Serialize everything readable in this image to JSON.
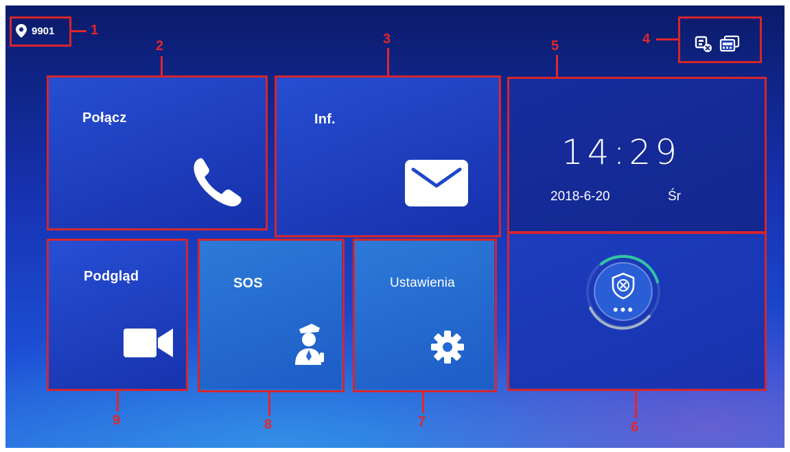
{
  "status_bar": {
    "room_number": "9901",
    "location_icon": "location-pin-icon",
    "status_icons": [
      "network-disconnected-icon",
      "monitor-windows-icon"
    ]
  },
  "tiles": {
    "call": {
      "label": "Połącz",
      "icon": "phone-icon"
    },
    "info": {
      "label": "Inf.",
      "icon": "envelope-icon"
    },
    "preview": {
      "label": "Podgląd",
      "icon": "video-camera-icon"
    },
    "sos": {
      "label": "SOS",
      "icon": "security-guard-icon"
    },
    "settings": {
      "label": "Ustawienia",
      "icon": "gear-icon"
    },
    "alarm": {
      "icon": "shield-disarmed-icon",
      "state_dots": "•••"
    }
  },
  "clock": {
    "time": "14:29",
    "date": "2018-6-20",
    "weekday": "Śr"
  },
  "callouts": [
    "1",
    "2",
    "3",
    "4",
    "5",
    "6",
    "7",
    "8",
    "9"
  ],
  "colors": {
    "accent_red": "#e3262b",
    "tile_blue": "#2450d0",
    "background_top": "#0b1b6a",
    "background_bottom": "#2a6ee0"
  }
}
